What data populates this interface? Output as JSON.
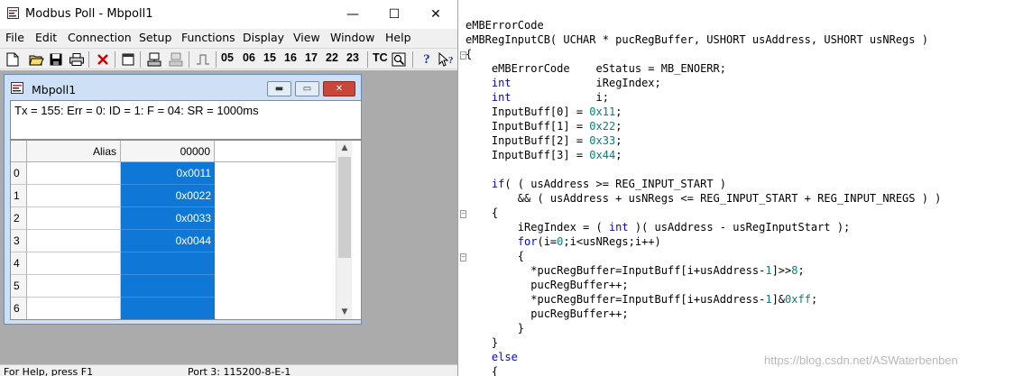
{
  "window": {
    "title": "Modbus Poll - Mbpoll1",
    "minimize": "—",
    "maximize": "☐",
    "close": "✕"
  },
  "menu": [
    "File",
    "Edit",
    "Connection",
    "Setup",
    "Functions",
    "Display",
    "View",
    "Window",
    "Help"
  ],
  "toolbar": {
    "function_codes": [
      "05",
      "06",
      "15",
      "16",
      "17",
      "22",
      "23"
    ],
    "tc_label": "TC",
    "icons": [
      "new-icon",
      "open-icon",
      "save-icon",
      "print-icon",
      "delete-icon",
      "window-icon",
      "read-icon",
      "write-icon",
      "pulse-icon",
      "scan-icon",
      "help-icon",
      "context-help-icon"
    ]
  },
  "child": {
    "title": "Mbpoll1",
    "status": "Tx = 155: Err = 0: ID = 1: F = 04: SR = 1000ms",
    "columns": {
      "alias": "Alias",
      "address": "00000"
    },
    "rows": [
      {
        "num": "0",
        "alias": "",
        "value": "0x0011"
      },
      {
        "num": "1",
        "alias": "",
        "value": "0x0022"
      },
      {
        "num": "2",
        "alias": "",
        "value": "0x0033"
      },
      {
        "num": "3",
        "alias": "",
        "value": "0x0044"
      },
      {
        "num": "4",
        "alias": "",
        "value": ""
      },
      {
        "num": "5",
        "alias": "",
        "value": ""
      },
      {
        "num": "6",
        "alias": "",
        "value": ""
      }
    ]
  },
  "statusbar": {
    "left": "For Help, press F1",
    "right": "Port 3: 115200-8-E-1"
  },
  "code": {
    "lines": [
      [
        {
          "t": "eMBErrorCode",
          "c": ""
        }
      ],
      [
        {
          "t": "eMBRegInputCB( UCHAR * pucRegBuffer, USHORT usAddress, USHORT usNRegs )",
          "c": ""
        }
      ],
      [
        {
          "t": "{",
          "c": ""
        }
      ],
      [
        {
          "t": "    eMBErrorCode    eStatus = MB_ENOERR;",
          "c": ""
        }
      ],
      [
        {
          "t": "    ",
          "c": ""
        },
        {
          "t": "int",
          "c": "kw"
        },
        {
          "t": "             iRegIndex;",
          "c": ""
        }
      ],
      [
        {
          "t": "    ",
          "c": ""
        },
        {
          "t": "int",
          "c": "kw"
        },
        {
          "t": "             i;",
          "c": ""
        }
      ],
      [
        {
          "t": "    InputBuff[0] = ",
          "c": ""
        },
        {
          "t": "0x11",
          "c": "num"
        },
        {
          "t": ";",
          "c": ""
        }
      ],
      [
        {
          "t": "    InputBuff[1] = ",
          "c": ""
        },
        {
          "t": "0x22",
          "c": "num"
        },
        {
          "t": ";",
          "c": ""
        }
      ],
      [
        {
          "t": "    InputBuff[2] = ",
          "c": ""
        },
        {
          "t": "0x33",
          "c": "num"
        },
        {
          "t": ";",
          "c": ""
        }
      ],
      [
        {
          "t": "    InputBuff[3] = ",
          "c": ""
        },
        {
          "t": "0x44",
          "c": "num"
        },
        {
          "t": ";",
          "c": ""
        }
      ],
      [
        {
          "t": "",
          "c": ""
        }
      ],
      [
        {
          "t": "    ",
          "c": ""
        },
        {
          "t": "if",
          "c": "kw"
        },
        {
          "t": "( ( usAddress >= REG_INPUT_START )",
          "c": ""
        }
      ],
      [
        {
          "t": "        && ( usAddress + usNRegs <= REG_INPUT_START + REG_INPUT_NREGS ) )",
          "c": ""
        }
      ],
      [
        {
          "t": "    {",
          "c": ""
        }
      ],
      [
        {
          "t": "        iRegIndex = ( ",
          "c": ""
        },
        {
          "t": "int",
          "c": "kw"
        },
        {
          "t": " )( usAddress - usRegInputStart );",
          "c": ""
        }
      ],
      [
        {
          "t": "        ",
          "c": ""
        },
        {
          "t": "for",
          "c": "kw"
        },
        {
          "t": "(i=",
          "c": ""
        },
        {
          "t": "0",
          "c": "num"
        },
        {
          "t": ";i<usNRegs;i++)",
          "c": ""
        }
      ],
      [
        {
          "t": "        {",
          "c": ""
        }
      ],
      [
        {
          "t": "          *pucRegBuffer=InputBuff[i+usAddress-",
          "c": ""
        },
        {
          "t": "1",
          "c": "num"
        },
        {
          "t": "]>>",
          "c": ""
        },
        {
          "t": "8",
          "c": "num"
        },
        {
          "t": ";",
          "c": ""
        }
      ],
      [
        {
          "t": "          pucRegBuffer++;",
          "c": ""
        }
      ],
      [
        {
          "t": "          *pucRegBuffer=InputBuff[i+usAddress-",
          "c": ""
        },
        {
          "t": "1",
          "c": "num"
        },
        {
          "t": "]&",
          "c": ""
        },
        {
          "t": "0xff",
          "c": "num"
        },
        {
          "t": ";",
          "c": ""
        }
      ],
      [
        {
          "t": "          pucRegBuffer++;",
          "c": ""
        }
      ],
      [
        {
          "t": "        }",
          "c": ""
        }
      ],
      [
        {
          "t": "    }",
          "c": ""
        }
      ],
      [
        {
          "t": "    ",
          "c": ""
        },
        {
          "t": "else",
          "c": "kw"
        }
      ],
      [
        {
          "t": "    {",
          "c": ""
        }
      ]
    ],
    "watermark": "https://blog.csdn.net/ASWaterbenben"
  },
  "colors": {
    "selection": "#0f78d7",
    "keyword": "#0000ff",
    "number": "#008080"
  }
}
